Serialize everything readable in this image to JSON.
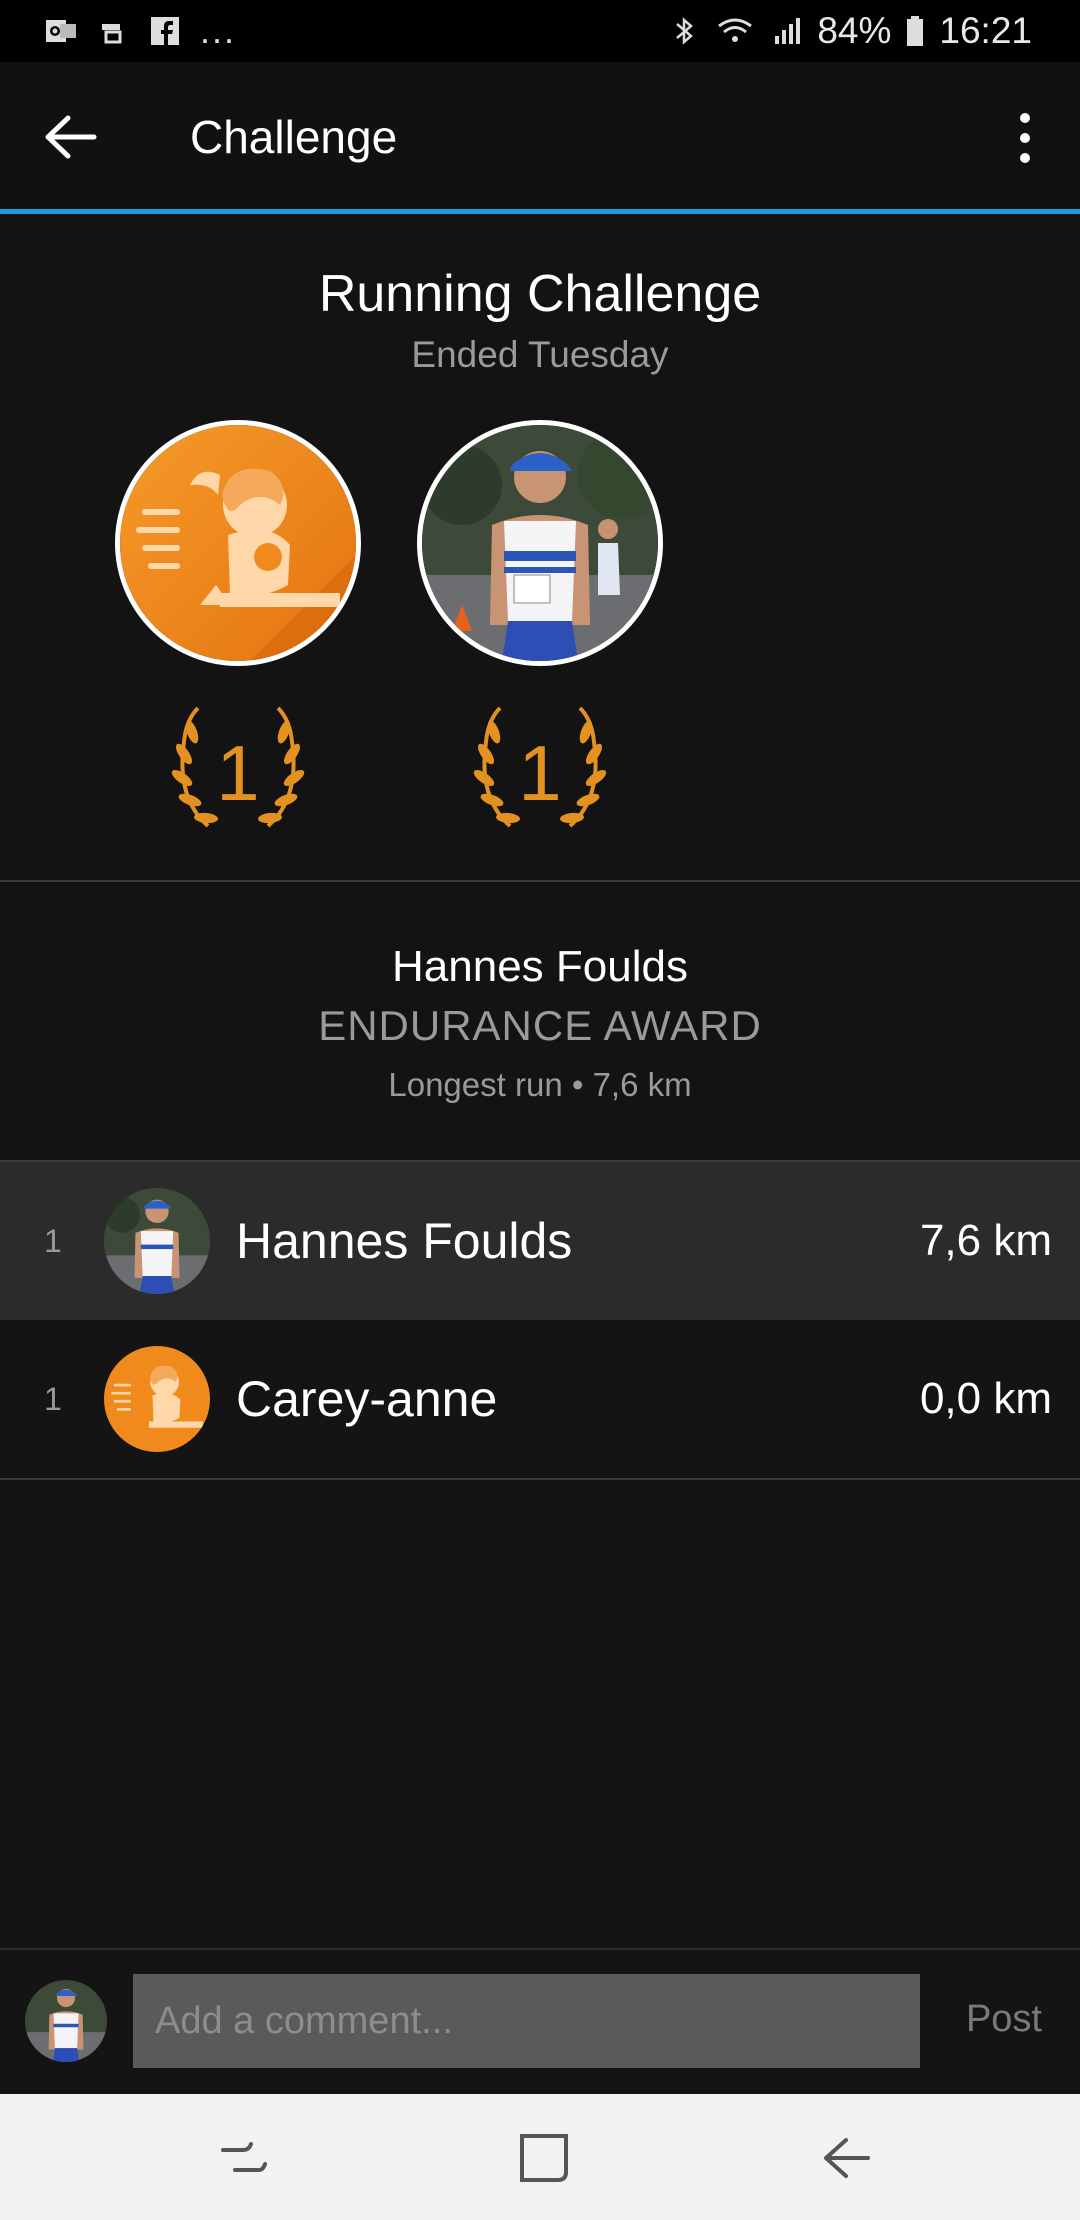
{
  "status_bar": {
    "left_icons": [
      "outlook-icon",
      "notification-icon",
      "facebook-icon"
    ],
    "more": "...",
    "battery": "84%",
    "time": "16:21"
  },
  "app_bar": {
    "title": "Challenge"
  },
  "challenge": {
    "title": "Running Challenge",
    "subtitle": "Ended Tuesday",
    "winners": [
      {
        "avatar": "runner-illustration",
        "rank": "1"
      },
      {
        "avatar": "runner-photo",
        "rank": "1"
      }
    ]
  },
  "award": {
    "name": "Hannes Foulds",
    "title": "ENDURANCE AWARD",
    "detail": "Longest run • 7,6 km"
  },
  "leaderboard": [
    {
      "rank": "1",
      "name": "Hannes Foulds",
      "value": "7,6 km",
      "highlighted": true
    },
    {
      "rank": "1",
      "name": "Carey-anne",
      "value": "0,0 km",
      "highlighted": false
    }
  ],
  "comment": {
    "placeholder": "Add a comment...",
    "post_label": "Post"
  },
  "colors": {
    "accent": "#1f9de0",
    "orange": "#f08a1c",
    "gold": "#e39222"
  }
}
